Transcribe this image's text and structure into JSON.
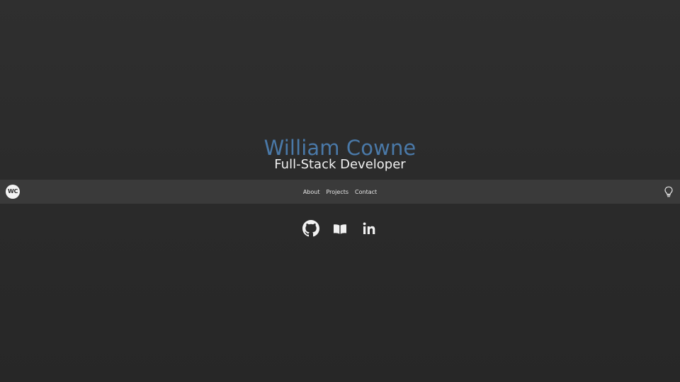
{
  "hero": {
    "name": "William Cowne",
    "role": "Full-Stack Developer"
  },
  "navbar": {
    "logo_text": "WC",
    "links": [
      "About",
      "Projects",
      "Contact"
    ],
    "theme_toggle_icon": "lightbulb-icon"
  },
  "socials": {
    "icons": [
      "github-icon",
      "book-icon",
      "linkedin-icon"
    ]
  },
  "colors": {
    "background": "#2c2c2c",
    "navbar": "#3a3a3a",
    "name_accent": "#4a79a8",
    "text": "#f1f1f1"
  }
}
